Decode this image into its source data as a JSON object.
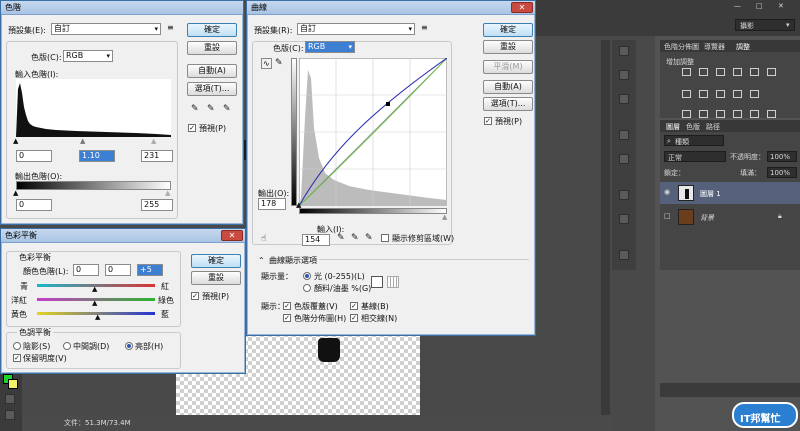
{
  "workspace": {
    "status_doc": "文件：51.3M/73.4M",
    "essentials": "攝影"
  },
  "levels": {
    "title": "色階",
    "preset_label": "預設集(E):",
    "preset_value": "自訂",
    "channel_label": "色版(C):",
    "channel_value": "RGB",
    "input_label": "輸入色階(I):",
    "input_values": [
      "0",
      "1.10",
      "231"
    ],
    "output_label": "輸出色階(O):",
    "output_values": [
      "0",
      "255"
    ],
    "buttons": {
      "ok": "確定",
      "reset": "重設",
      "auto": "自動(A)",
      "options": "選項(T)..."
    },
    "preview": "預視(P)"
  },
  "curves": {
    "title": "曲線",
    "preset_label": "預設集(R):",
    "preset_value": "自訂",
    "channel_label": "色版(C):",
    "channel_value": "RGB",
    "output_label": "輸出(O):",
    "output_value": "178",
    "input_label": "輸入(I):",
    "input_value": "154",
    "clipping": "顯示修剪區域(W)",
    "display_options": "曲線顯示選項",
    "show_amount": "顯示量：",
    "light_option": "光 (0-255)(L)",
    "pigment_option": "顏料/油墨 %(G)",
    "show": "顯示：",
    "channel_overlays": "色版覆蓋(V)",
    "baseline": "基線(B)",
    "histogram": "色階分佈圖(H)",
    "intersection": "相交線(N)",
    "buttons": {
      "ok": "確定",
      "reset": "重設",
      "smooth": "平滑(M)",
      "auto": "自動(A)",
      "options": "選項(T)..."
    },
    "preview": "預視(P)",
    "histogram_color": "#bcbcbc",
    "curve_color": "#2a2ab0"
  },
  "color_balance": {
    "title": "色彩平衡",
    "section": "色彩平衡",
    "levels_label": "顏色色階(L):",
    "levels_values": [
      "0",
      "0",
      "+5"
    ],
    "sliders": [
      {
        "left": "青",
        "right": "紅"
      },
      {
        "left": "洋紅",
        "right": "綠色"
      },
      {
        "left": "黃色",
        "right": "藍"
      }
    ],
    "tone_section": "色調平衡",
    "tones": [
      "陰影(S)",
      "中間調(D)",
      "亮部(H)"
    ],
    "preserve": "保留明度(V)",
    "buttons": {
      "ok": "確定",
      "reset": "重設"
    },
    "preview": "預視(P)"
  },
  "panels": {
    "tabs_top": [
      "色階分佈圖",
      "導覽器",
      "調整"
    ],
    "add_adjustment": "增加調整",
    "tabs_layers": [
      "圖層",
      "色版",
      "路徑"
    ],
    "kind": "種類",
    "blend_mode": "正常",
    "opacity_label": "不透明度：",
    "opacity_value": "100%",
    "lock_label": "鎖定：",
    "fill_label": "填滿：",
    "fill_value": "100%",
    "layers": [
      {
        "name": "圖層 1",
        "selected": true
      },
      {
        "name": "背景",
        "selected": false
      }
    ],
    "watermark": "IT邦幫忙"
  }
}
